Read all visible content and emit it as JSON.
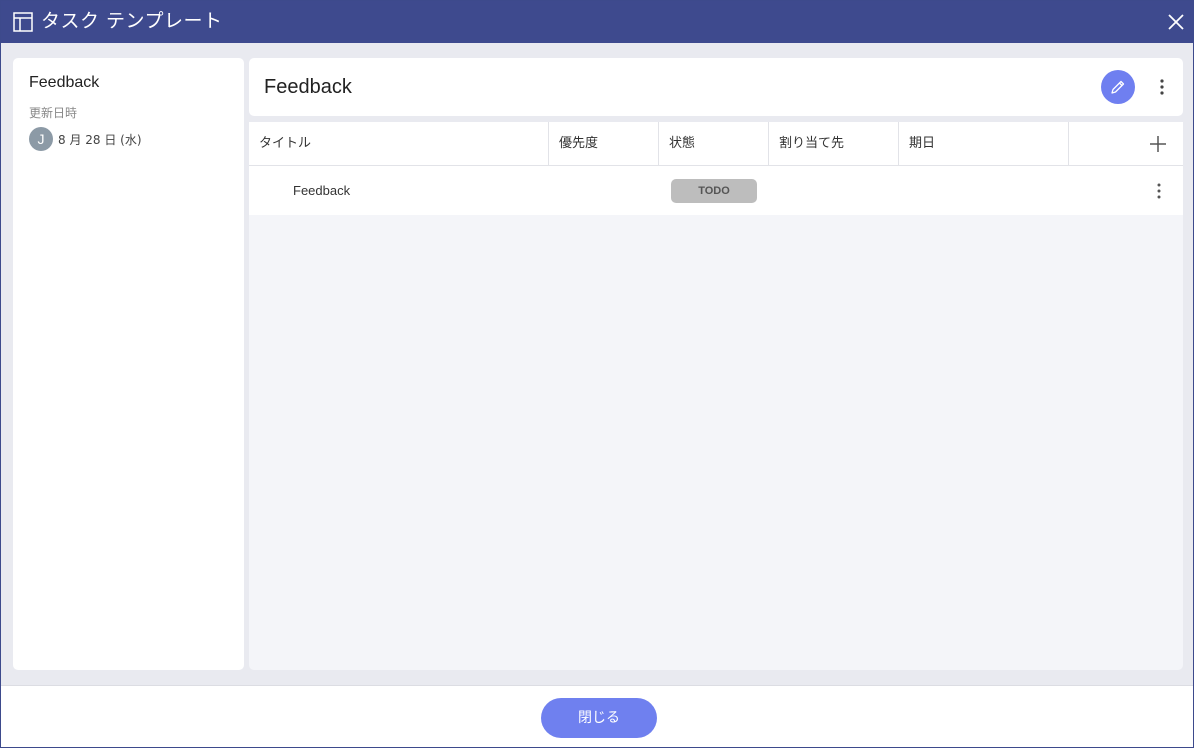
{
  "window": {
    "title": "タスク テンプレート",
    "close_icon": "close-icon",
    "app_icon": "template-layout-icon",
    "accent_color": "#3e4a8e"
  },
  "left_panel": {
    "title": "Feedback",
    "updated_label": "更新日時",
    "avatar_initial": "J",
    "updated_date": "8 月 28 日 (水)"
  },
  "main": {
    "title": "Feedback",
    "edit_icon": "pencil-icon",
    "more_icon": "more-vertical-icon",
    "columns": [
      "タイトル",
      "優先度",
      "状態",
      "割り当て先",
      "期日"
    ],
    "add_column_icon": "plus-icon",
    "rows": [
      {
        "title": "Feedback",
        "priority": "",
        "status": "TODO",
        "assignee": "",
        "due": ""
      }
    ]
  },
  "footer": {
    "close_label": "閉じる",
    "button_color": "#6f80ef"
  }
}
